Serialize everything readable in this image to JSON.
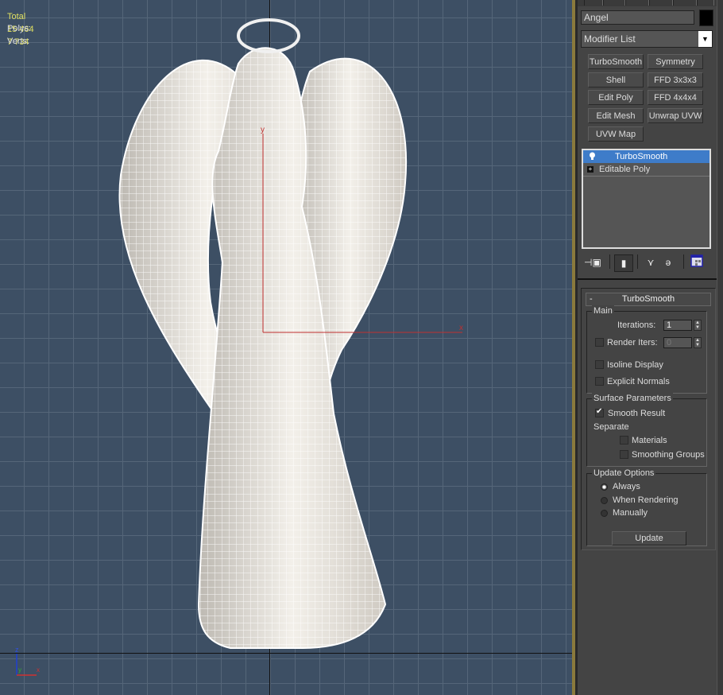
{
  "viewport": {
    "stats": {
      "header": "Total",
      "rows": [
        {
          "label": "Polys:",
          "value": "15 464"
        },
        {
          "label": "Verts:",
          "value": "7 734"
        }
      ]
    },
    "gizmo": {
      "y_label": "y",
      "x_label": "x"
    },
    "corner_axes": {
      "z": "z",
      "x": "x",
      "y": "y"
    },
    "colors": {
      "background": "#3d4f64",
      "grid": "#556679",
      "stats_text": "#e0e060",
      "axis_red": "#c03030"
    }
  },
  "command_panel": {
    "object_name": "Angel",
    "object_color": "#000000",
    "modifier_list": {
      "selected": "Modifier List"
    },
    "modifier_buttons": [
      "TurboSmooth",
      "Symmetry",
      "Shell",
      "FFD 3x3x3",
      "Edit Poly",
      "FFD 4x4x4",
      "Edit Mesh",
      "Unwrap UVW",
      "UVW Map"
    ],
    "stack": [
      {
        "label": "TurboSmooth",
        "selected": true,
        "icon": "lightbulb-icon"
      },
      {
        "label": "Editable Poly",
        "selected": false,
        "icon": "expand-plus-icon"
      }
    ],
    "stack_tools": [
      "pin-stack-icon",
      "show-end-result-icon",
      "make-unique-icon",
      "remove-modifier-icon",
      "configure-modifier-sets-icon"
    ],
    "rollout": {
      "title": "TurboSmooth",
      "collapse_symbol": "-",
      "main": {
        "title": "Main",
        "iterations_label": "Iterations:",
        "iterations_value": "1",
        "render_iters_label": "Render Iters:",
        "render_iters_value": "0",
        "render_iters_checked": false,
        "isoline_display_label": "Isoline Display",
        "isoline_display_checked": false,
        "explicit_normals_label": "Explicit Normals",
        "explicit_normals_checked": false
      },
      "surface": {
        "title": "Surface Parameters",
        "smooth_result_label": "Smooth Result",
        "smooth_result_checked": true,
        "separate_label": "Separate",
        "materials_label": "Materials",
        "materials_checked": false,
        "smoothing_groups_label": "Smoothing Groups",
        "smoothing_groups_checked": false
      },
      "update": {
        "title": "Update Options",
        "options": [
          "Always",
          "When Rendering",
          "Manually"
        ],
        "selected": "Always",
        "button_label": "Update"
      }
    }
  }
}
